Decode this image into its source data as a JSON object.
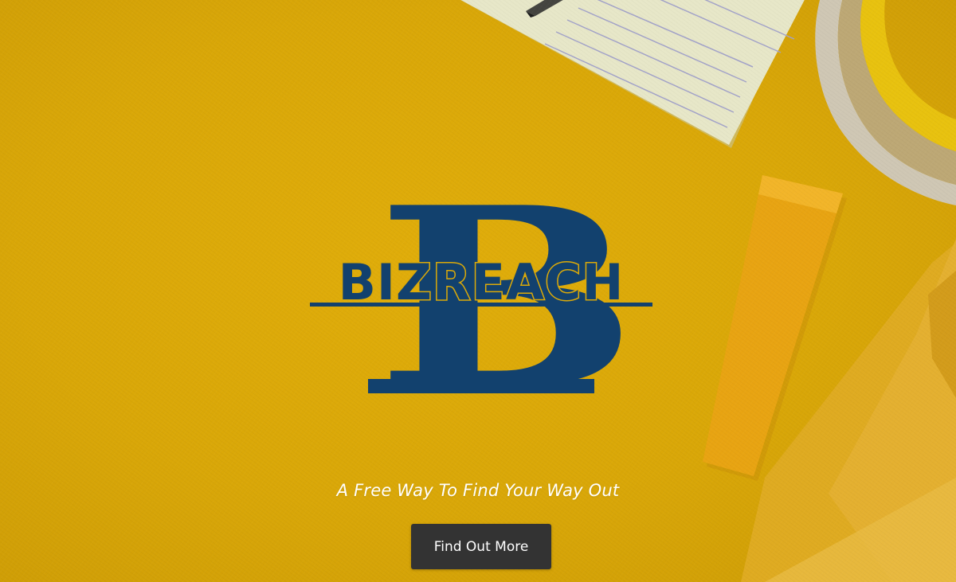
{
  "brand": {
    "logo_letter": "B",
    "logo_name": "BIZREACH",
    "logo_color": "#12416e"
  },
  "hero": {
    "tagline": "A Free Way To Find Your Way Out",
    "cta_label": "Find Out More",
    "background_color": "#dcaa08"
  },
  "colors": {
    "button_bg": "#333333",
    "button_text": "#ffffff",
    "tagline_text": "#ffffff"
  },
  "icons": {
    "scene": [
      "notepad-icon",
      "pencil-icon",
      "scissors-icon",
      "sticky-strip-icon",
      "envelope-icon"
    ]
  }
}
